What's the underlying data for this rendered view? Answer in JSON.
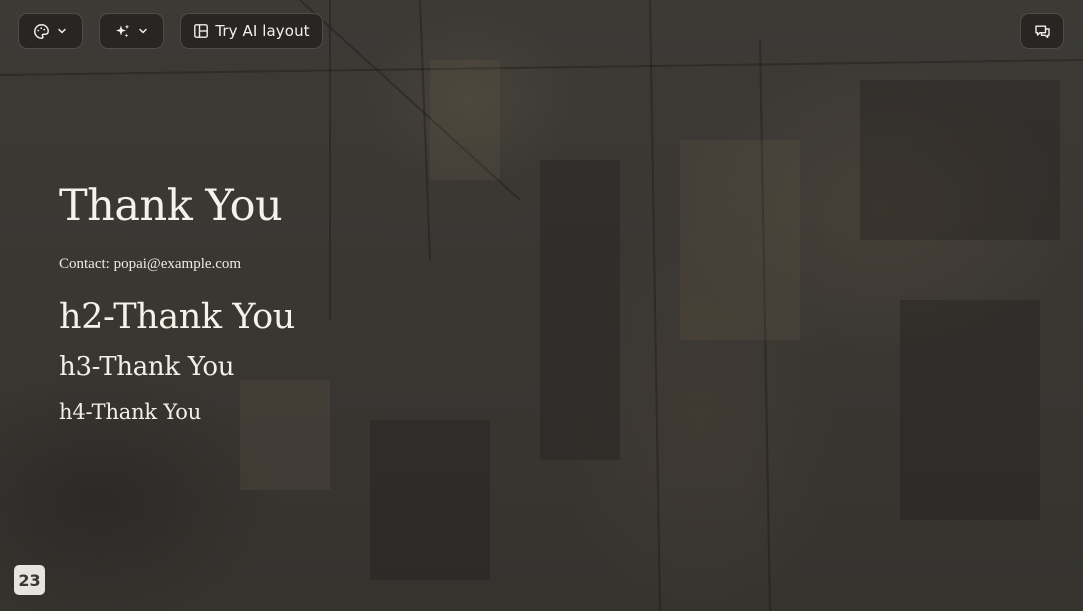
{
  "toolbar": {
    "theme_button": {
      "icon": "palette-icon",
      "dropdown_icon": "chevron-down-icon"
    },
    "ai_button": {
      "icon": "sparkles-icon",
      "dropdown_icon": "chevron-down-icon"
    },
    "layout_button": {
      "icon": "layout-icon",
      "label": "Try AI layout"
    },
    "comment_button": {
      "icon": "comment-icon"
    }
  },
  "slide": {
    "title": "Thank You",
    "contact": "Contact: popai@example.com",
    "h2": "h2-Thank You",
    "h3": "h3-Thank You",
    "h4": "h4-Thank You",
    "page_number": "23"
  },
  "colors": {
    "background": "#3b3834",
    "text": "#f6f2ea",
    "page_badge_bg": "#e7e4de",
    "page_badge_text": "#3a3733"
  }
}
